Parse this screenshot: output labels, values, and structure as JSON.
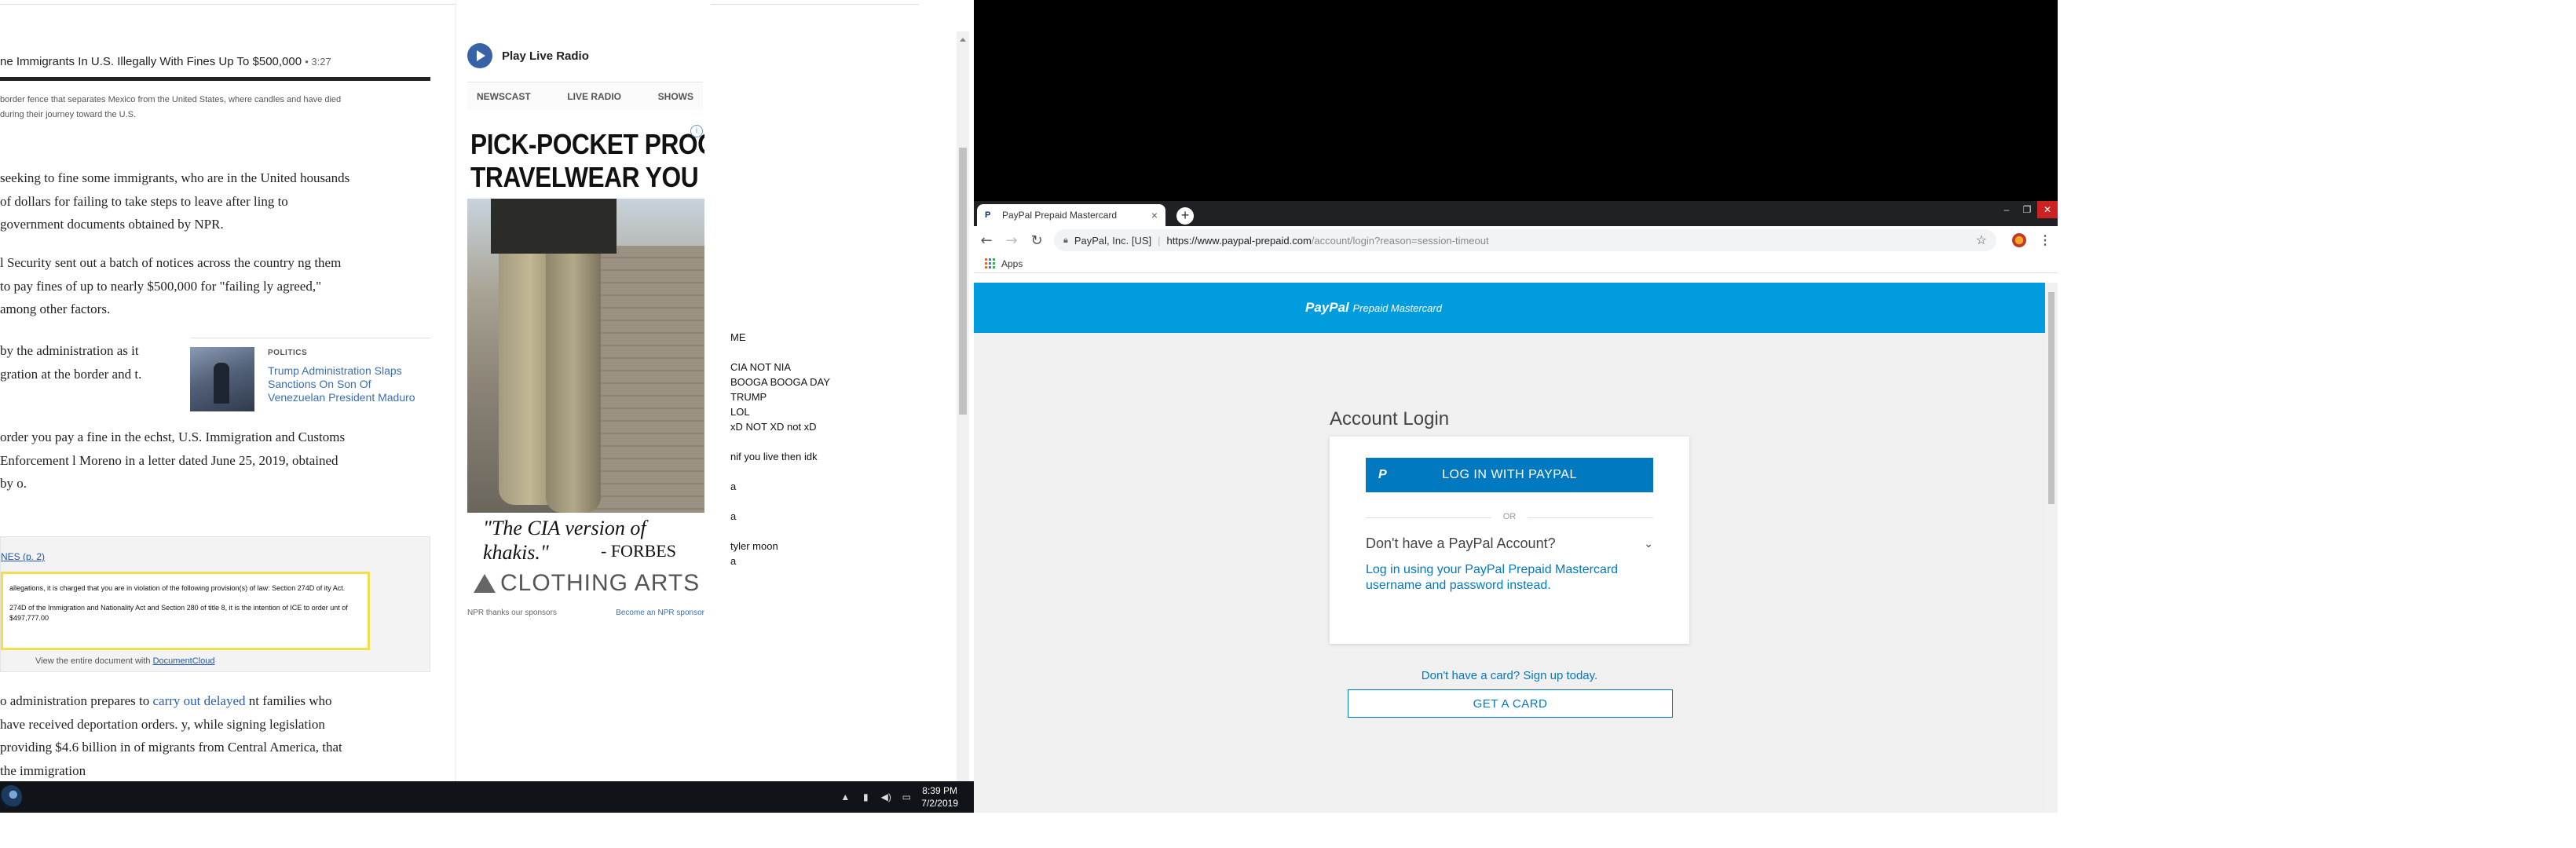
{
  "article": {
    "audio_title": "ne Immigrants In U.S. Illegally With Fines Up To $500,000",
    "audio_duration": "3:27",
    "image_caption": "border fence that separates Mexico from the United States, where candles and have died during their journey toward the U.S.",
    "paragraphs": [
      "seeking to fine some immigrants, who are in the United housands of dollars for failing to take steps to leave after ling to government documents obtained by NPR.",
      "l Security sent out a batch of notices across the country ng them to pay fines of up to nearly $500,000 for \"failing ly agreed,\" among other factors.",
      "by the administration as it gration at the border and t.",
      "order you pay a fine in the echst, U.S. Immigration and Customs Enforcement l Moreno in a letter dated June 25, 2019, obtained by o.",
      "o administration prepares to carry out delayed nt families who have received deportation orders. y, while signing legislation providing $4.6 billion in of migrants from Central America, that the immigration"
    ],
    "para5_link": "carry out delayed",
    "related": {
      "category": "POLITICS",
      "title": "Trump Administration Slaps Sanctions On Son Of Venezuelan President Maduro"
    },
    "document": {
      "link_text": "NES (p. 2)",
      "lines": [
        "allegations, it is charged that you are in violation of the following provision(s) of law: Section 274D of ity Act.",
        "274D of the Immigration and Nationality Act and Section 280 of title 8, it is the intention of ICE to order unt of $497,777.00"
      ],
      "footer_prefix": "View the entire document with",
      "footer_link": "DocumentCloud"
    }
  },
  "sidebar": {
    "live_radio": "Play Live Radio",
    "tabs": [
      "NEWSCAST",
      "LIVE RADIO",
      "SHOWS"
    ],
    "ad": {
      "headline_line1": "PICK-POCKET PROOF",
      "headline_line2": "TRAVELWEAR YOU WANT",
      "quote": "\"The CIA version of khakis.\"",
      "source": "- FORBES",
      "brand": "CLOTHING ARTS"
    },
    "sponsor_note": "NPR thanks our sponsors",
    "become_sponsor": "Become an NPR sponsor"
  },
  "notes": "ME\n\nCIA NOT NIA\nBOOGA BOOGA DAY\nTRUMP\nLOL\nxD NOT XD not xD\n\nnif you live then idk\n\na\n\na\n\ntyler moon\na",
  "taskbar": {
    "time": "8:39 PM",
    "date": "7/2/2019"
  },
  "browser": {
    "tab_title": "PayPal Prepaid Mastercard",
    "org": "PayPal, Inc. [US]",
    "url_host": "https://www.paypal-prepaid.com",
    "url_rest": "/account/login?reason=session-timeout",
    "bookmarks_label": "Apps"
  },
  "paypal": {
    "logo": "PayPal",
    "logo_sub": "Prepaid Mastercard",
    "login_title": "Account Login",
    "login_button": "LOG IN WITH PAYPAL",
    "or": "OR",
    "no_account": "Don't have a PayPal Account?",
    "alt_login": "Log in using your PayPal Prepaid Mastercard username and password instead.",
    "signup": "Don't have a card? Sign up today.",
    "get_card": "GET A CARD",
    "brand_color": "#009cde",
    "button_color": "#0079c1"
  }
}
